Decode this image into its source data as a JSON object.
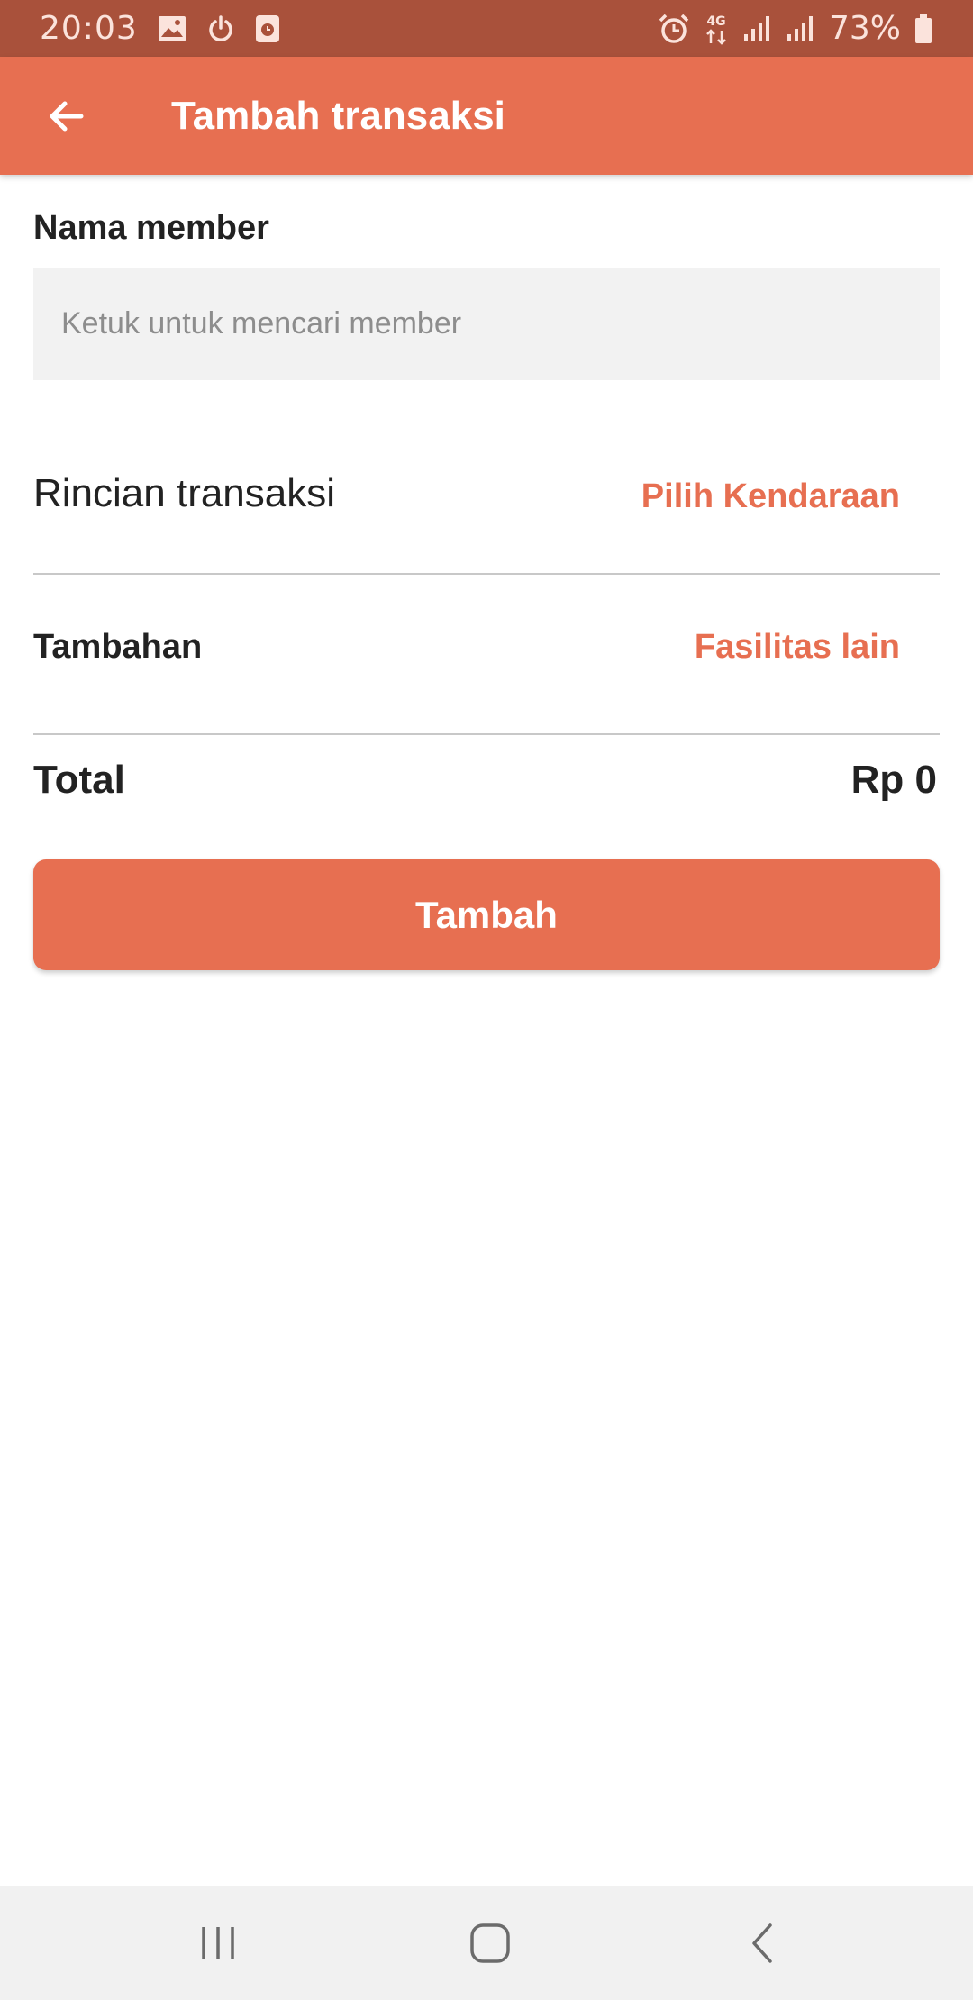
{
  "status_bar": {
    "time": "20:03",
    "network": "4G",
    "battery": "73%"
  },
  "app_bar": {
    "title": "Tambah transaksi",
    "back_icon": "arrow-left-icon"
  },
  "member": {
    "label": "Nama member",
    "placeholder": "Ketuk untuk mencari member",
    "value": ""
  },
  "details": {
    "title": "Rincian transaksi",
    "action": "Pilih Kendaraan"
  },
  "extras": {
    "label": "Tambahan",
    "action": "Fasilitas lain"
  },
  "total": {
    "label": "Total",
    "value": "Rp 0"
  },
  "submit": {
    "label": "Tambah"
  },
  "nav": {
    "recents_icon": "recents-icon",
    "home_icon": "home-icon",
    "back_icon": "back-icon"
  },
  "colors": {
    "primary": "#e76f51",
    "status_bar": "#a9513b"
  }
}
